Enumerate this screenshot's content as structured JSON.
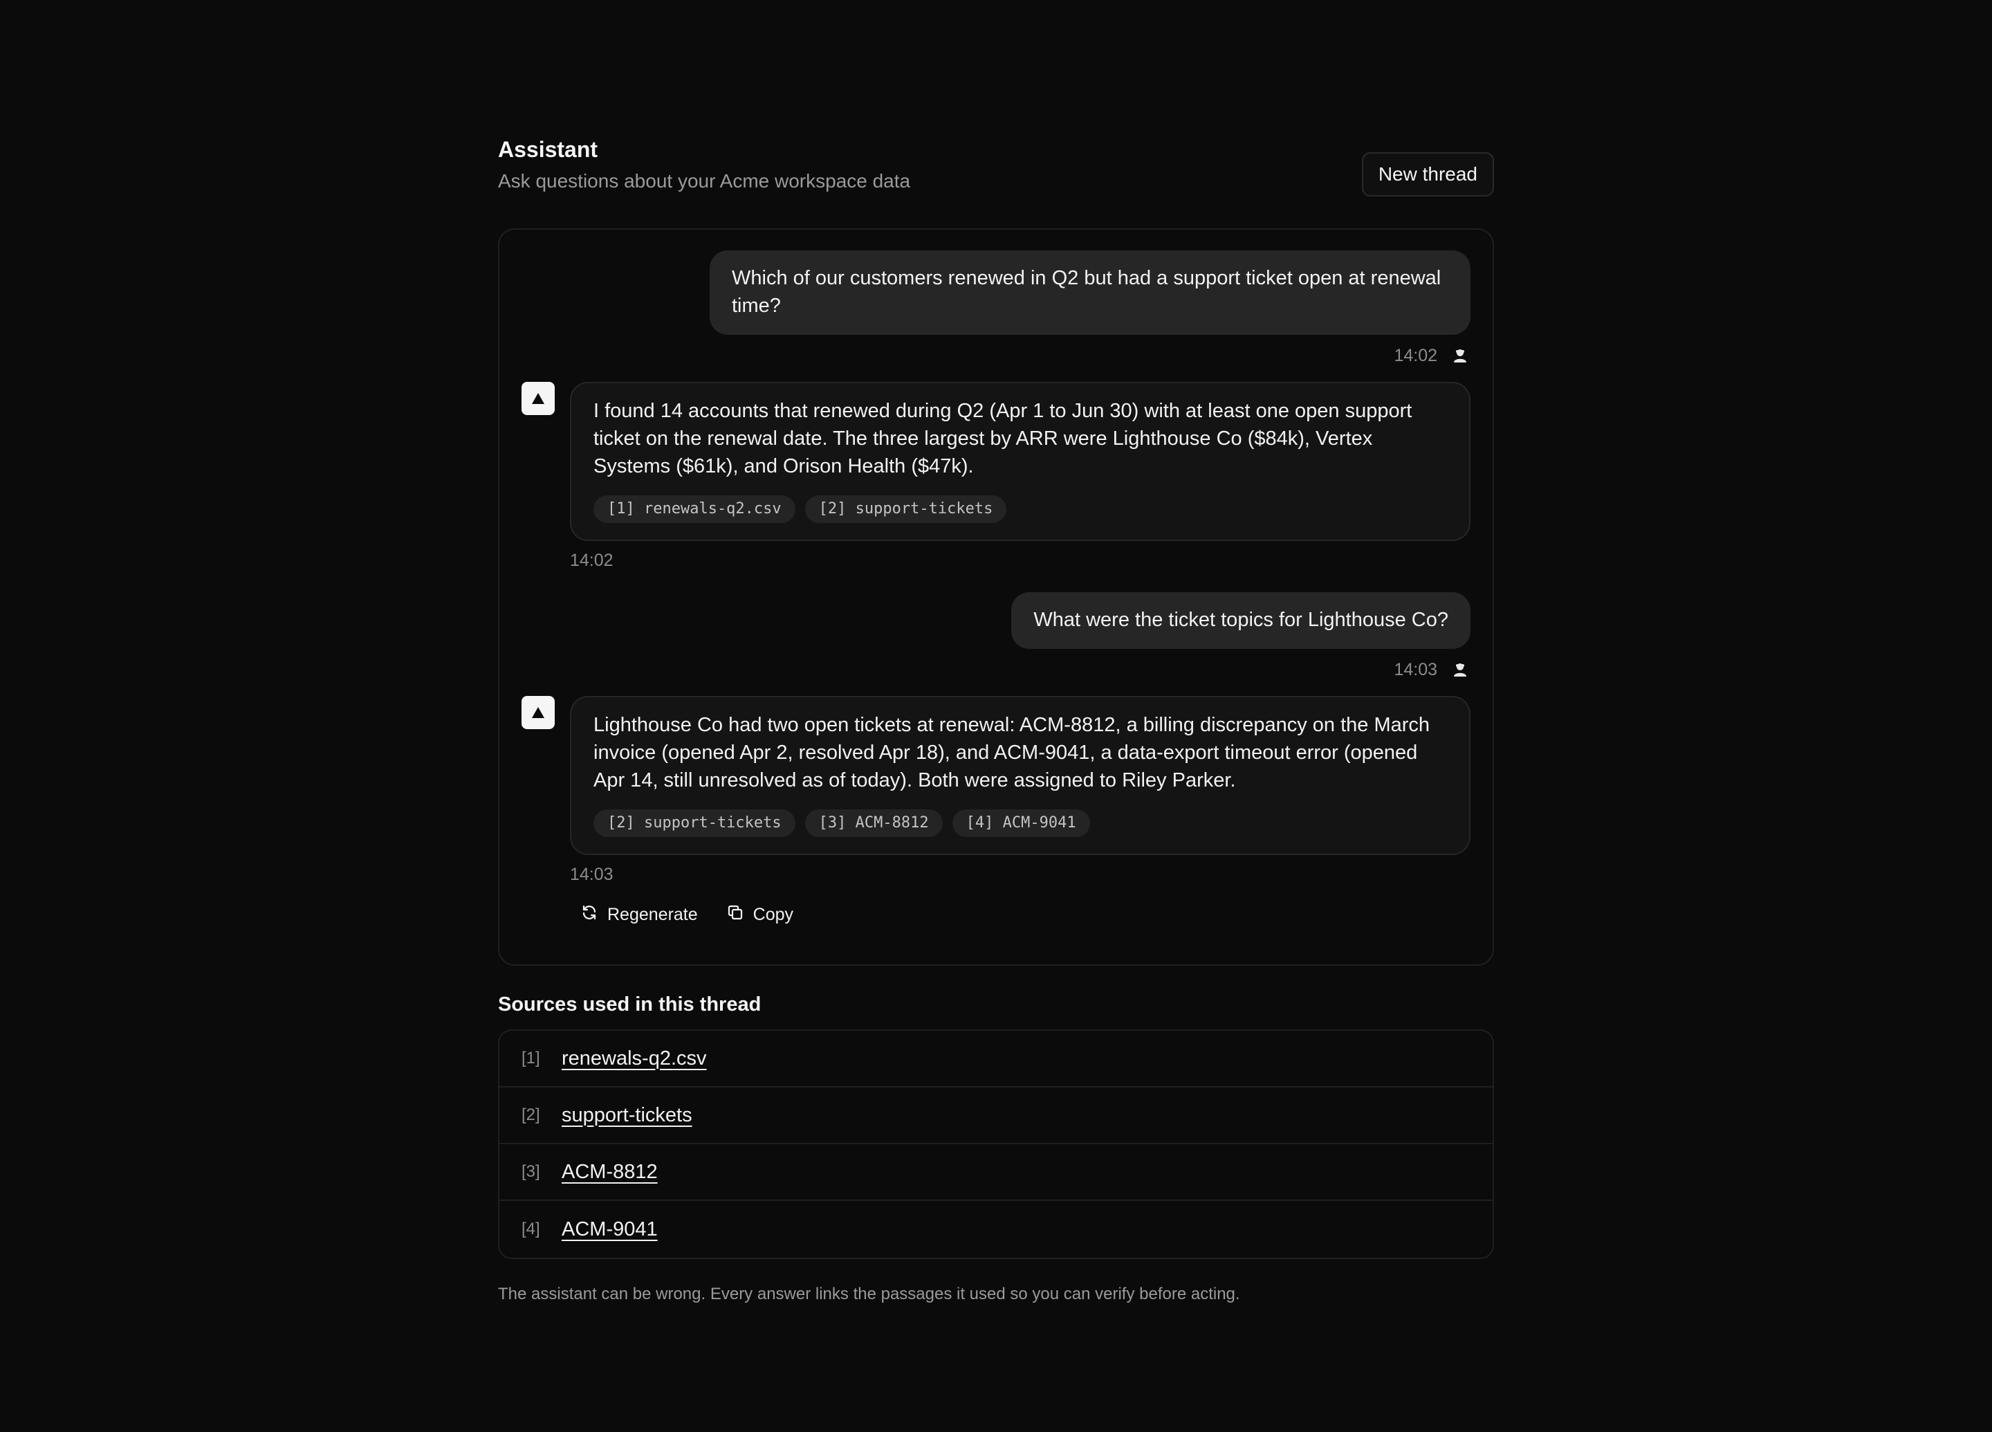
{
  "header": {
    "title": "Assistant",
    "subtitle": "Ask questions about your Acme workspace data",
    "new_thread_label": "New thread"
  },
  "messages": [
    {
      "role": "user",
      "text": "Which of our customers renewed in Q2 but had a support ticket open at renewal time?",
      "time": "14:02"
    },
    {
      "role": "assistant",
      "text": "I found 14 accounts that renewed during Q2 (Apr 1 to Jun 30) with at least one open support ticket on the renewal date. The three largest by ARR were Lighthouse Co ($84k), Vertex Systems ($61k), and Orison Health ($47k).",
      "citations": [
        "[1] renewals-q2.csv",
        "[2] support-tickets"
      ],
      "time": "14:02"
    },
    {
      "role": "user",
      "text": "What were the ticket topics for Lighthouse Co?",
      "time": "14:03"
    },
    {
      "role": "assistant",
      "text": "Lighthouse Co had two open tickets at renewal: ACM-8812, a billing discrepancy on the March invoice (opened Apr 2, resolved Apr 18), and ACM-9041, a data-export timeout error (opened Apr 14, still unresolved as of today). Both were assigned to Riley Parker.",
      "citations": [
        "[2] support-tickets",
        "[3] ACM-8812",
        "[4] ACM-9041"
      ],
      "time": "14:03"
    }
  ],
  "actions": {
    "regenerate_label": "Regenerate",
    "copy_label": "Copy"
  },
  "sources": {
    "title": "Sources used in this thread",
    "items": [
      {
        "index": "[1]",
        "label": "renewals-q2.csv"
      },
      {
        "index": "[2]",
        "label": "support-tickets"
      },
      {
        "index": "[3]",
        "label": "ACM-8812"
      },
      {
        "index": "[4]",
        "label": "ACM-9041"
      }
    ]
  },
  "disclaimer": "The assistant can be wrong. Every answer links the passages it used so you can verify before acting.",
  "icons": {
    "assistant_avatar": "triangle-icon",
    "user_avatar": "user-icon",
    "regenerate": "refresh-icon",
    "copy": "copy-icon"
  },
  "colors": {
    "background": "#0b0b0b",
    "user_bubble": "#262626",
    "assistant_bubble": "#141414",
    "text": "#f2f2f2",
    "muted": "#8c8c8c"
  }
}
